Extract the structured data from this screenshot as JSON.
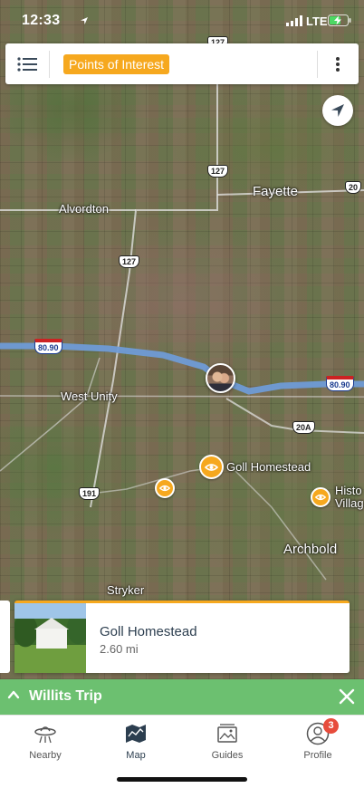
{
  "status_bar": {
    "time": "12:33",
    "network": "LTE"
  },
  "header": {
    "filter_chip": "Points of Interest"
  },
  "map": {
    "labels": {
      "fayette": "Fayette",
      "alvordton": "Alvordton",
      "west_unity": "West Unity",
      "archbold": "Archbold",
      "stryker": "Stryker",
      "goll_homestead": "Goll Homestead",
      "historic_village_line1": "Histo",
      "historic_village_line2": "Villag"
    },
    "shields": {
      "us127_top": "127",
      "us127_mid": "127",
      "us127_low": "127",
      "us20": "20",
      "i80_90_left": "80.90",
      "i80_90_right": "80.90",
      "us20a": "20A",
      "sr191": "191"
    }
  },
  "card": {
    "title": "Goll Homestead",
    "distance": "2.60 mi"
  },
  "trip": {
    "title": "Willits Trip"
  },
  "tabs": [
    {
      "label": "Nearby",
      "icon": "ufo-icon"
    },
    {
      "label": "Map",
      "icon": "map-icon"
    },
    {
      "label": "Guides",
      "icon": "guides-icon"
    },
    {
      "label": "Profile",
      "icon": "profile-icon",
      "badge": "3"
    }
  ],
  "colors": {
    "accent": "#f6a81e",
    "trip_bar": "#6cc070",
    "route": "#6f9bd6",
    "badge": "#e74c3c"
  }
}
